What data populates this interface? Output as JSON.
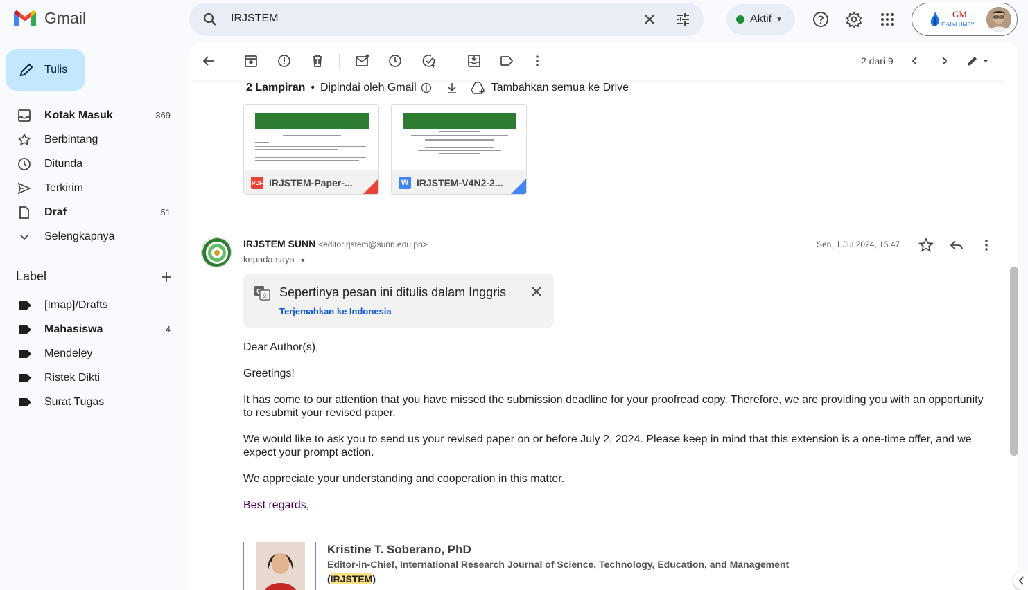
{
  "app": {
    "name": "Gmail"
  },
  "search": {
    "query": "IRJSTEM"
  },
  "status": {
    "label": "Aktif",
    "color": "#1e8e3e"
  },
  "account": {
    "logo_top": "GM",
    "logo_bottom": "E-Mail UMBY"
  },
  "compose": {
    "label": "Tulis"
  },
  "nav": {
    "items": [
      {
        "label": "Kotak Masuk",
        "count": "369",
        "icon": "inbox-icon"
      },
      {
        "label": "Berbintang",
        "count": "",
        "icon": "star-icon"
      },
      {
        "label": "Ditunda",
        "count": "",
        "icon": "clock-icon"
      },
      {
        "label": "Terkirim",
        "count": "",
        "icon": "send-icon"
      },
      {
        "label": "Draf",
        "count": "51",
        "icon": "draft-icon"
      },
      {
        "label": "Selengkapnya",
        "count": "",
        "icon": "chevron-down-icon"
      }
    ]
  },
  "labels": {
    "heading": "Label",
    "items": [
      {
        "label": "[Imap]/Drafts",
        "count": ""
      },
      {
        "label": "Mahasiswa",
        "count": "4"
      },
      {
        "label": "Mendeley",
        "count": ""
      },
      {
        "label": "Ristek Dikti",
        "count": ""
      },
      {
        "label": "Surat Tugas",
        "count": ""
      }
    ]
  },
  "toolbar": {
    "pager": "2 dari 9"
  },
  "attachments": {
    "title": "2 Lampiran",
    "scanned": "Dipindai oleh Gmail",
    "add_drive": "Tambahkan semua ke Drive",
    "files": [
      {
        "name": "IRJSTEM-Paper-...",
        "type": "PDF",
        "color": "#ea4335"
      },
      {
        "name": "IRJSTEM-V4N2-2...",
        "type": "W",
        "color": "#4285f4"
      }
    ]
  },
  "message": {
    "sender_name": "IRJSTEM SUNN",
    "sender_email": "<editorirjstem@sunn.edu.ph>",
    "to": "kepada saya",
    "date": "Sen, 1 Jul 2024, 15.47",
    "translate_title": "Sepertinya pesan ini ditulis dalam Inggris",
    "translate_link": "Terjemahkan ke Indonesia",
    "paragraphs": [
      "Dear Author(s),",
      "Greetings!",
      "It has come to our attention that you have missed the submission deadline for your proofread copy. Therefore, we are providing you with an opportunity to resubmit your revised paper.",
      "We would like to ask you to send us your revised paper on or before July 2, 2024. Please keep in mind that this extension is a one-time offer, and we expect your prompt action.",
      "We appreciate your understanding and cooperation in this matter.",
      "Best regards,"
    ],
    "signature": {
      "name": "Kristine T. Soberano, PhD",
      "title": "Editor-in-Chief, International Research Journal of Science, Technology, Education, and Management",
      "abbr_open": "(",
      "abbr": "IRJSTEM",
      "abbr_close": ")"
    }
  }
}
